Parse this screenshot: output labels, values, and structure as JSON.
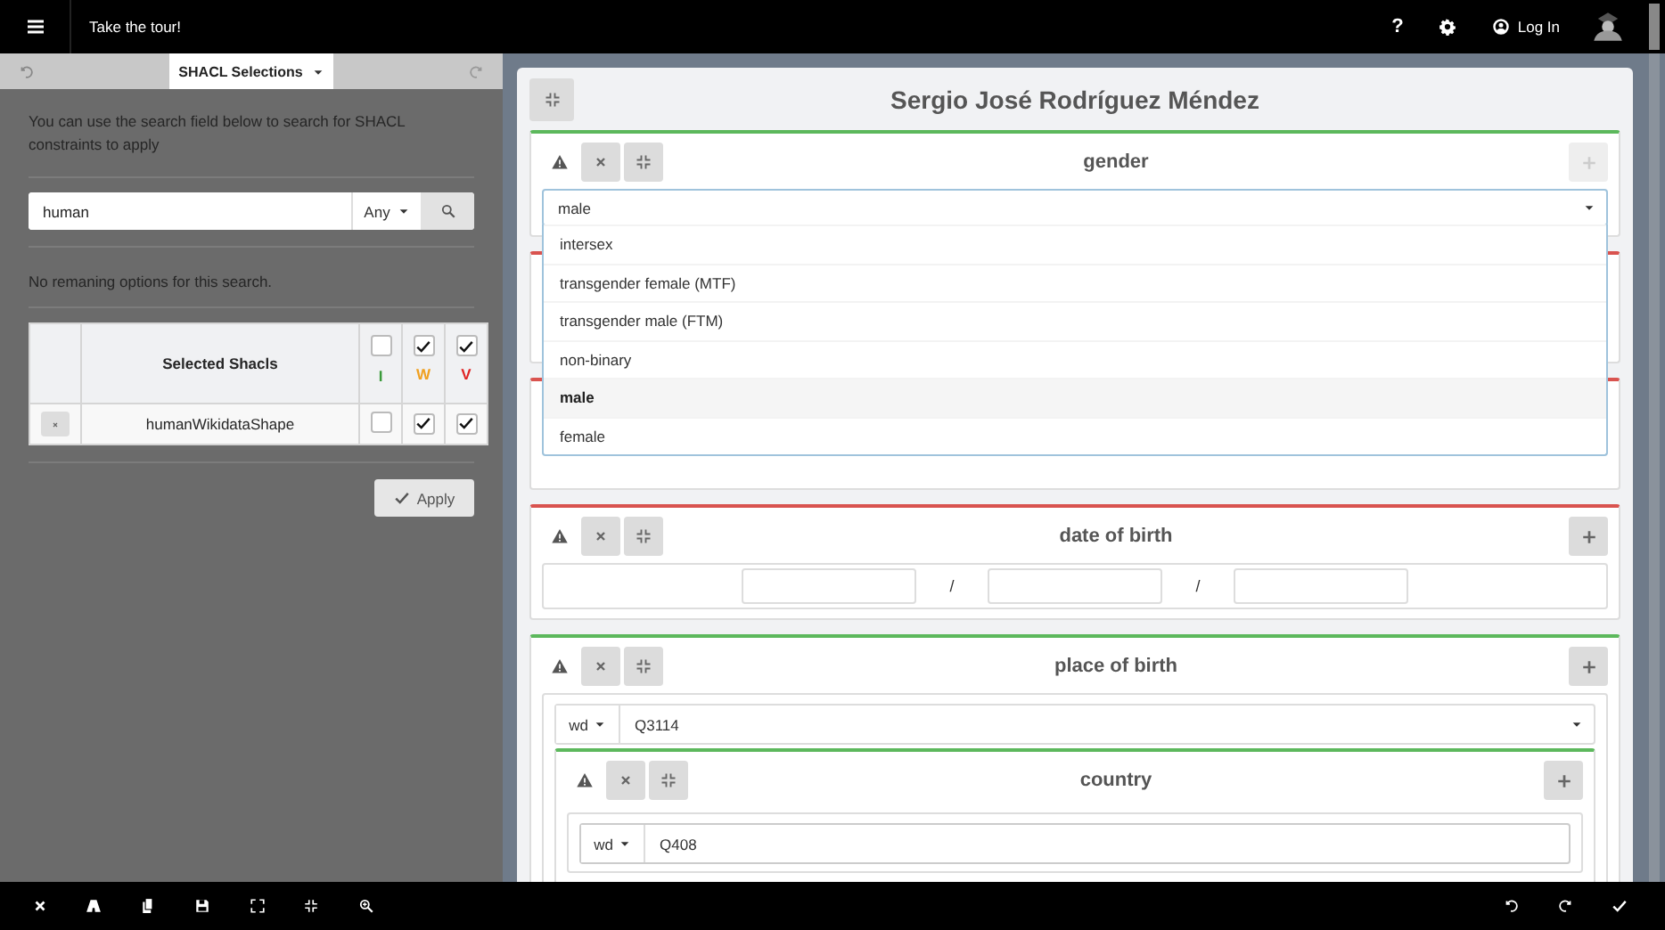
{
  "top_bar": {
    "tour_link": "Take the tour!",
    "help": "?",
    "login": "Log In"
  },
  "left_panel": {
    "tab": "SHACL Selections",
    "description": "You can use the search field below to search for SHACL constraints to apply",
    "search": {
      "value": "human",
      "scope": "Any"
    },
    "message": "No remaning options for this search.",
    "table": {
      "columns": [
        {
          "label": "Selected Shacls"
        },
        {
          "label": "I",
          "color": "#3a9a3a",
          "checked": false
        },
        {
          "label": "W",
          "color": "#f0a020",
          "checked": true
        },
        {
          "label": "V",
          "color": "#e02424",
          "checked": true
        }
      ],
      "rows": [
        {
          "name": "humanWikidataShape",
          "checks": [
            false,
            true,
            true
          ]
        }
      ]
    },
    "apply_button": "Apply"
  },
  "editor": {
    "title": "Sergio José Rodríguez Méndez",
    "sections": [
      {
        "kind": "select",
        "title": "gender",
        "color": "#5cb85c",
        "add_enabled": false,
        "value": "male",
        "expanded": true,
        "options": [
          {
            "label": "intersex",
            "selected": false
          },
          {
            "label": "transgender female (MTF)",
            "selected": false
          },
          {
            "label": "transgender male (FTM)",
            "selected": false
          },
          {
            "label": "non-binary",
            "selected": false
          },
          {
            "label": "male",
            "selected": true
          },
          {
            "label": "female",
            "selected": false
          }
        ]
      },
      {
        "kind": "hidden",
        "color": "#d9534f"
      },
      {
        "kind": "hidden",
        "color": "#d9534f"
      },
      {
        "kind": "date",
        "title": "date of birth",
        "color": "#d9534f",
        "add_enabled": true,
        "separators": [
          "/",
          "/"
        ]
      },
      {
        "kind": "item",
        "title": "place of birth",
        "color": "#5cb85c",
        "add_enabled": true,
        "prefix": "wd",
        "value": "Q3114",
        "dropdown": true,
        "children": [
          {
            "kind": "item",
            "title": "country",
            "color": "#5cb85c",
            "add_enabled": true,
            "prefix": "wd",
            "value": "Q408",
            "dropdown": false
          }
        ]
      }
    ]
  }
}
